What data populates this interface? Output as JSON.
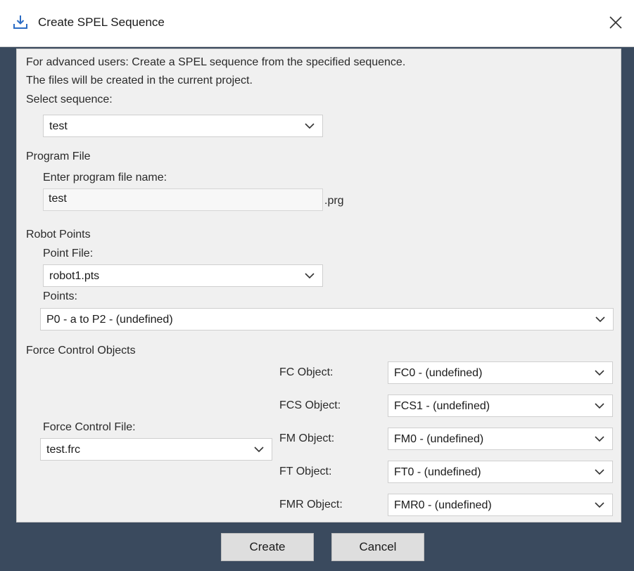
{
  "dialog": {
    "title": "Create SPEL Sequence",
    "title_icon": "download-tray-icon",
    "close_icon": "close-icon"
  },
  "intro": {
    "line1": "For advanced users: Create a SPEL sequence from the specified sequence.",
    "line2": "The files will be created in the current project."
  },
  "sequence": {
    "label": "Select sequence:",
    "value": "test"
  },
  "program_file": {
    "section": "Program File",
    "label": "Enter program file name:",
    "value": "test",
    "extension": ".prg"
  },
  "robot_points": {
    "section": "Robot Points",
    "point_file_label": "Point File:",
    "point_file_value": "robot1.pts",
    "points_label": "Points:",
    "points_value": "P0 - a to P2 - (undefined)"
  },
  "force_control": {
    "section": "Force Control Objects",
    "file_label": "Force Control File:",
    "file_value": "test.frc",
    "objects": [
      {
        "label": "FC Object:",
        "value": "FC0 - (undefined)"
      },
      {
        "label": "FCS Object:",
        "value": "FCS1 - (undefined)"
      },
      {
        "label": "FM Object:",
        "value": "FM0 - (undefined)"
      },
      {
        "label": "FT Object:",
        "value": "FT0 - (undefined)"
      },
      {
        "label": "FMR Object:",
        "value": "FMR0 - (undefined)"
      }
    ]
  },
  "buttons": {
    "create": "Create",
    "cancel": "Cancel"
  }
}
